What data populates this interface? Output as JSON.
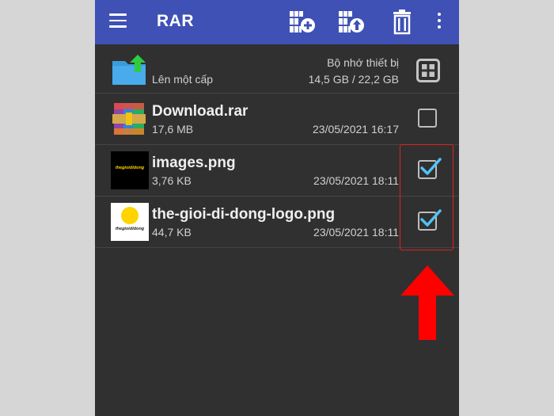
{
  "appbar": {
    "title": "RAR",
    "icons": [
      "menu-icon",
      "add-to-archive-icon",
      "extract-icon",
      "delete-icon",
      "more-options-icon"
    ],
    "color": "#3f51b5"
  },
  "parent_row": {
    "label": "Lên một cấp",
    "storage_label": "Bộ nhớ thiết bị",
    "storage_usage": "14,5 GB / 22,2 GB",
    "icon": "folder-up-icon"
  },
  "files": [
    {
      "name": "Download.rar",
      "size": "17,6 MB",
      "date": "23/05/2021 16:17",
      "checked": false,
      "icon": "rar-archive-icon"
    },
    {
      "name": "images.png",
      "size": "3,76 KB",
      "date": "23/05/2021 18:11",
      "checked": true,
      "thumb_text": "thegioididong"
    },
    {
      "name": "the-gioi-di-dong-logo.png",
      "size": "44,7 KB",
      "date": "23/05/2021 18:11",
      "checked": true,
      "thumb_text": "thegioididong"
    }
  ],
  "colors": {
    "background": "#303030",
    "check": "#4fc3f7",
    "annotation": "#ff0000"
  }
}
